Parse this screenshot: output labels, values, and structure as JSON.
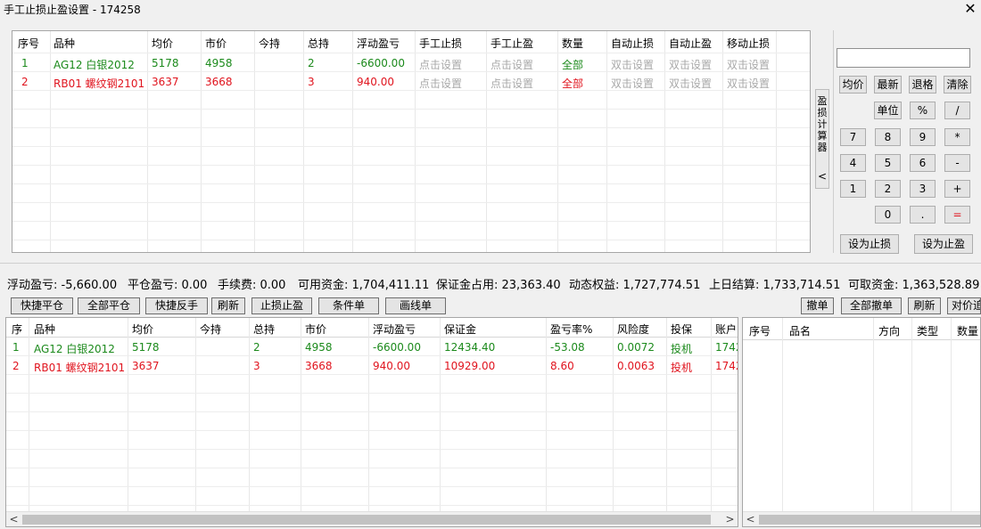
{
  "dialog": {
    "title": "手工止损止盈设置 - 174258",
    "close_glyph": "✕",
    "grid": {
      "headers": [
        "序号",
        "品种",
        "均价",
        "市价",
        "今持",
        "总持",
        "浮动盈亏",
        "手工止损",
        "手工止盈",
        "数量",
        "自动止损",
        "自动止盈",
        "移动止损"
      ],
      "rows": [
        [
          "1",
          "AG12 白银2012",
          "5178",
          "4958",
          "",
          "2",
          "-6600.00",
          "点击设置",
          "点击设置",
          "全部",
          "双击设置",
          "双击设置",
          "双击设置"
        ],
        [
          "2",
          "RB01 螺纹钢2101",
          "3637",
          "3668",
          "",
          "3",
          "940.00",
          "点击设置",
          "点击设置",
          "全部",
          "双击设置",
          "双击设置",
          "双击设置"
        ]
      ]
    },
    "calc_tab_label": "盈损计算器",
    "calc_tab_arrow": "<",
    "calc_buttons": {
      "avg": "均价",
      "latest": "最新",
      "backspace": "退格",
      "clear": "清除",
      "unit": "单位",
      "percent": "%",
      "divide": "/",
      "n7": "7",
      "n8": "8",
      "n9": "9",
      "multiply": "*",
      "n4": "4",
      "n5": "5",
      "n6": "6",
      "minus": "-",
      "n1": "1",
      "n2": "2",
      "n3": "3",
      "plus": "+",
      "n0": "0",
      "dot": ".",
      "equals": "=",
      "set_stop_loss": "设为止损",
      "set_take_profit": "设为止盈"
    }
  },
  "status": {
    "float_pl": "浮动盈亏: -5,660.00",
    "close_pl": "平仓盈亏: 0.00",
    "fee": "手续费: 0.00",
    "available": "可用资金: 1,704,411.11",
    "margin_used": "保证金占用: 23,363.40",
    "dynamic_equity": "动态权益: 1,727,774.51",
    "prev_settle": "上日结算: 1,733,714.51",
    "withdrawable": "可取资金: 1,363,528.89"
  },
  "toolbar": {
    "quick_close": "快捷平仓",
    "close_all": "全部平仓",
    "quick_reverse": "快捷反手",
    "refresh": "刷新",
    "stop_loss_profit": "止损止盈",
    "conditional": "条件单",
    "draw_line": "画线单",
    "cancel": "撤单",
    "cancel_all": "全部撤单",
    "refresh2": "刷新",
    "counter_price": "对价追"
  },
  "positions": {
    "headers": [
      "序",
      "品种",
      "均价",
      "今持",
      "总持",
      "市价",
      "浮动盈亏",
      "保证金",
      "盈亏率%",
      "风险度",
      "投保",
      "账户"
    ],
    "rows": [
      [
        "1",
        "AG12 白银2012",
        "5178",
        "",
        "2",
        "4958",
        "-6600.00",
        "12434.40",
        "-53.08",
        "0.0072",
        "投机",
        "1742"
      ],
      [
        "2",
        "RB01 螺纹钢2101",
        "3637",
        "",
        "3",
        "3668",
        "940.00",
        "10929.00",
        "8.60",
        "0.0063",
        "投机",
        "1742"
      ]
    ]
  },
  "orders": {
    "headers": [
      "序号",
      "品名",
      "方向",
      "类型",
      "数量"
    ]
  },
  "scroll": {
    "left": "<",
    "right": ">"
  },
  "colors": {
    "profit": "#e0141e",
    "loss": "#1c8a1c",
    "disabled": "#a8a8a8"
  }
}
